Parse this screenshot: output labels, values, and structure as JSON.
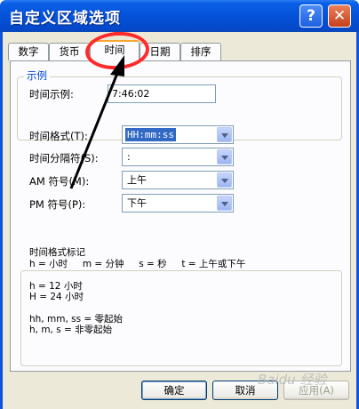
{
  "window": {
    "title": "自定义区域选项"
  },
  "tabs": [
    "数字",
    "货币",
    "时间",
    "日期",
    "排序"
  ],
  "active_tab": "时间",
  "sample": {
    "group_title": "示例",
    "label": "时间示例:",
    "value": "7:46:02"
  },
  "fields": [
    {
      "label": "时间格式(T):",
      "value": "HH:mm:ss"
    },
    {
      "label": "时间分隔符(S):",
      "value": ":"
    },
    {
      "label": "AM 符号(M):",
      "value": "上午"
    },
    {
      "label": "PM 符号(P):",
      "value": "下午"
    }
  ],
  "notes": [
    "时间格式标记",
    "h = 小时     m = 分钟     s = 秒     t = 上午或下午",
    "h = 12 小时",
    "H = 24 小时",
    "hh, mm, ss = 零起始",
    "h, m, s = 非零起始"
  ],
  "buttons": {
    "ok": "确定",
    "cancel": "取消",
    "apply": "应用(A)"
  },
  "watermark": "Baidu 经验",
  "colors": {
    "titlebar": "#0553d9",
    "annotation": "#ff2a2a",
    "selection": "#316ac5"
  }
}
